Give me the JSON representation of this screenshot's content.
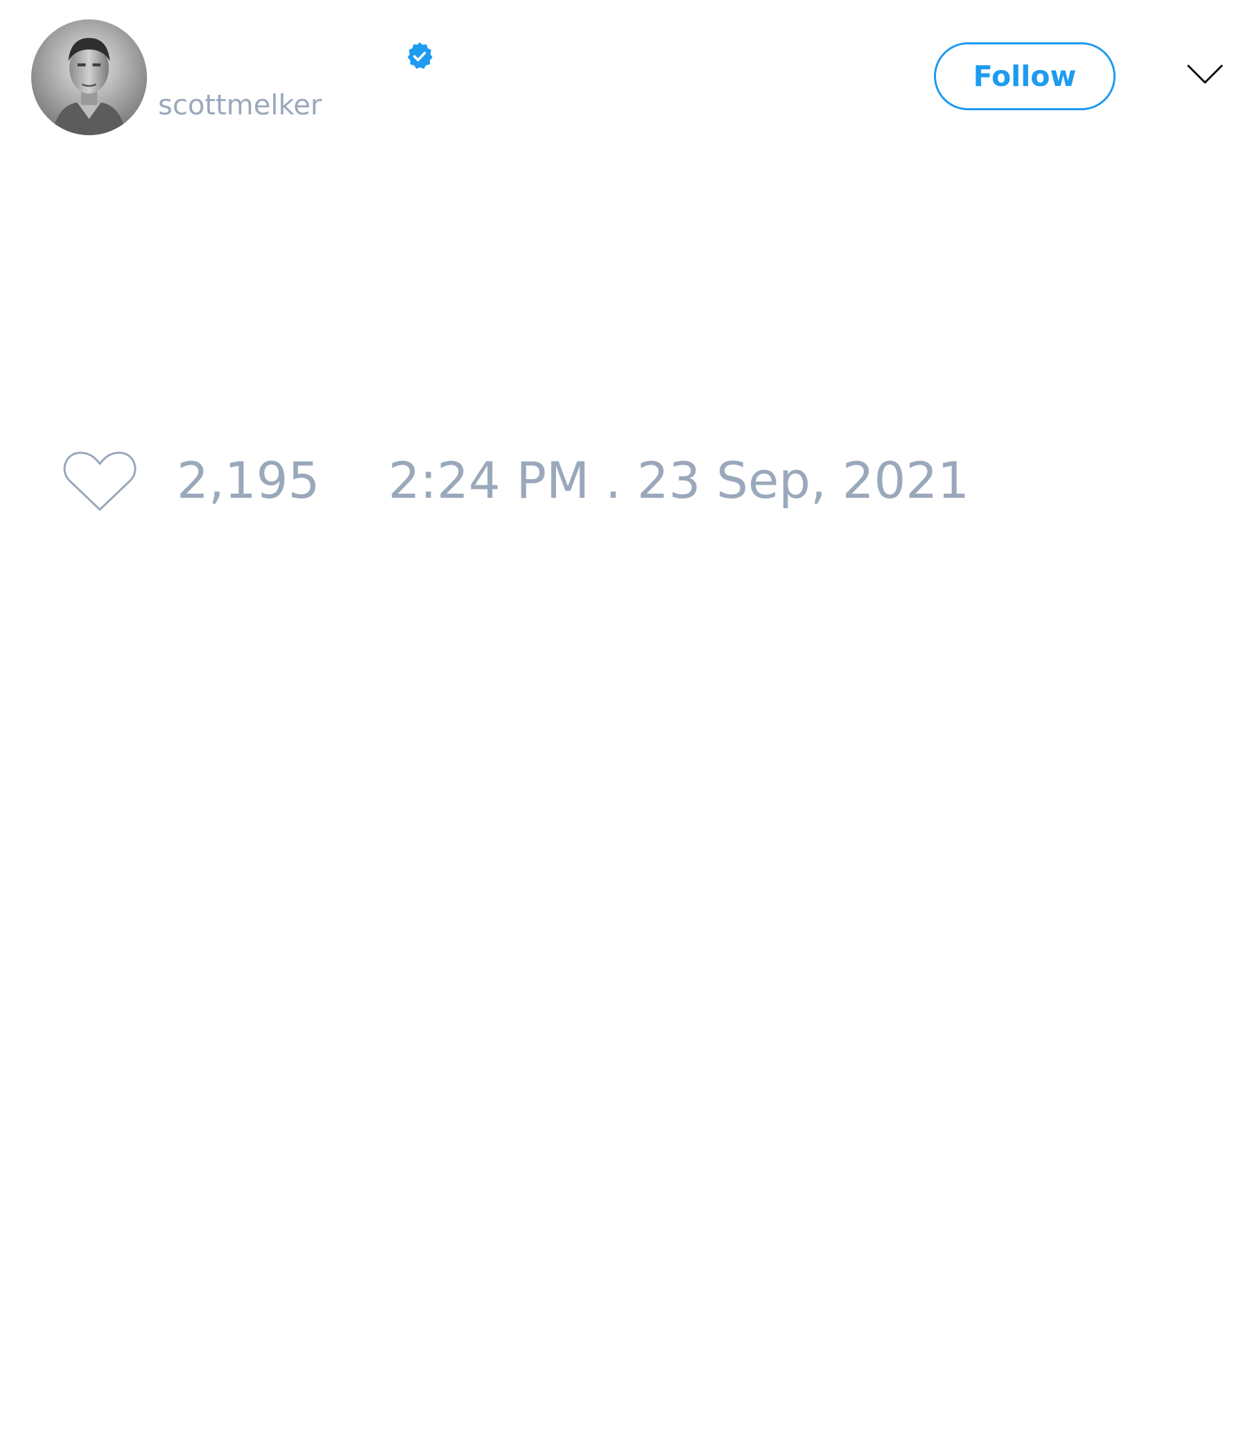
{
  "tweet": {
    "author": {
      "handle": "scottmelker",
      "avatar": "profile-photo",
      "verified_icon": "verified-badge-icon"
    },
    "actions": {
      "follow_label": "Follow",
      "menu_icon": "chevron-down-icon"
    },
    "footer": {
      "like_icon": "heart-outline-icon",
      "like_count": "2,195",
      "timestamp": "2:24 PM . 23 Sep, 2021"
    }
  },
  "colors": {
    "accent": "#1d9bf0",
    "muted_text": "#9aa8bb",
    "background": "#ffffff"
  }
}
